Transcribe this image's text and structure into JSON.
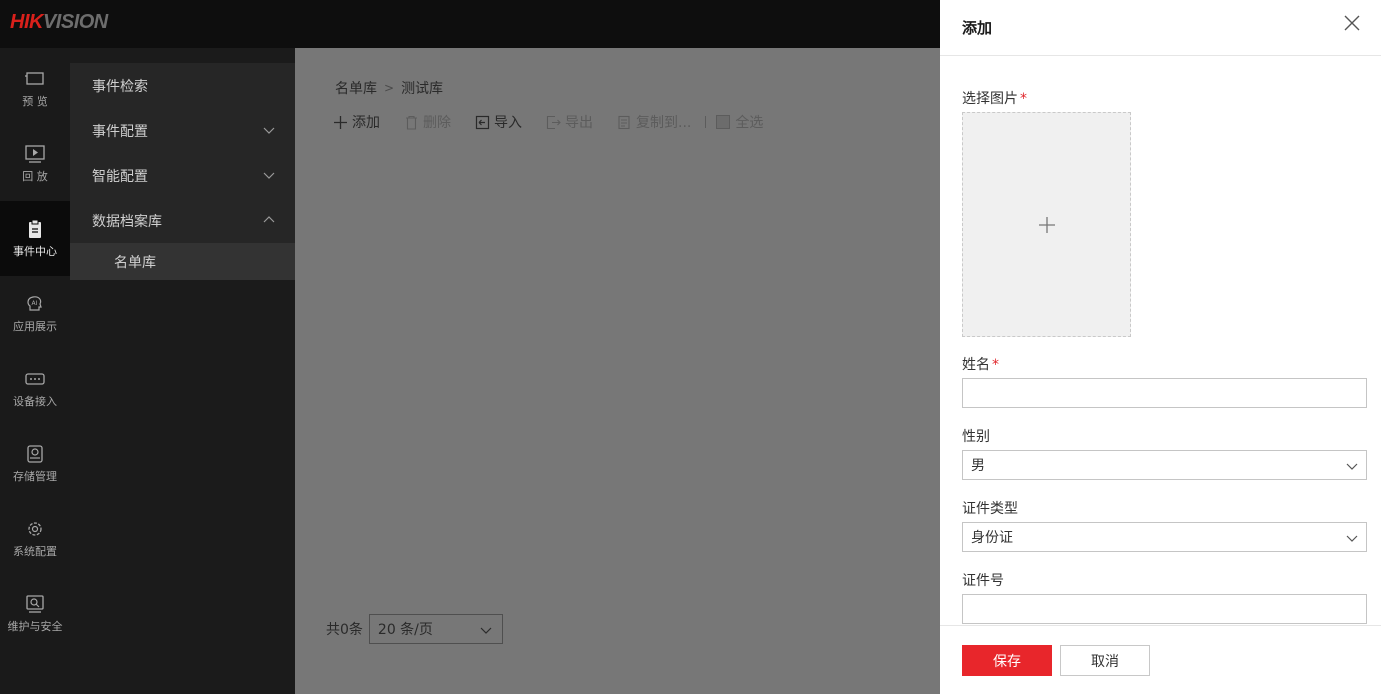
{
  "logo": {
    "part1": "HIK",
    "part2": "VISION"
  },
  "rail": {
    "items": [
      {
        "label": "预 览",
        "icon": "monitor-icon",
        "active": false
      },
      {
        "label": "回 放",
        "icon": "playback-icon",
        "active": false
      },
      {
        "label": "事件中心",
        "icon": "clipboard-icon",
        "active": true
      },
      {
        "label": "应用展示",
        "icon": "ai-icon",
        "active": false
      },
      {
        "label": "设备接入",
        "icon": "device-icon",
        "active": false
      },
      {
        "label": "存储管理",
        "icon": "storage-icon",
        "active": false
      },
      {
        "label": "系统配置",
        "icon": "gear-icon",
        "active": false
      },
      {
        "label": "维护与安全",
        "icon": "maintenance-icon",
        "active": false
      }
    ]
  },
  "submenu": {
    "items": [
      {
        "label": "事件检索",
        "expandable": false
      },
      {
        "label": "事件配置",
        "expandable": true,
        "expanded": false
      },
      {
        "label": "智能配置",
        "expandable": true,
        "expanded": false
      },
      {
        "label": "数据档案库",
        "expandable": true,
        "expanded": true
      }
    ],
    "child": "名单库"
  },
  "main": {
    "breadcrumb": [
      "名单库",
      "测试库"
    ],
    "toolbar": {
      "add": "添加",
      "delete": "删除",
      "import": "导入",
      "export": "导出",
      "copy": "复制到...",
      "select_all": "全选"
    },
    "pager": {
      "total": "共0条",
      "page_size": "20 条/页"
    }
  },
  "drawer": {
    "title": "添加",
    "image_label": "选择图片",
    "name_label": "姓名",
    "name_value": "",
    "gender_label": "性别",
    "gender_value": "男",
    "id_type_label": "证件类型",
    "id_type_value": "身份证",
    "id_no_label": "证件号",
    "id_no_value": "",
    "required_mark": "*",
    "save": "保存",
    "cancel": "取消"
  },
  "colors": {
    "brand": "#d9201b",
    "primary_button": "#e8262b"
  }
}
